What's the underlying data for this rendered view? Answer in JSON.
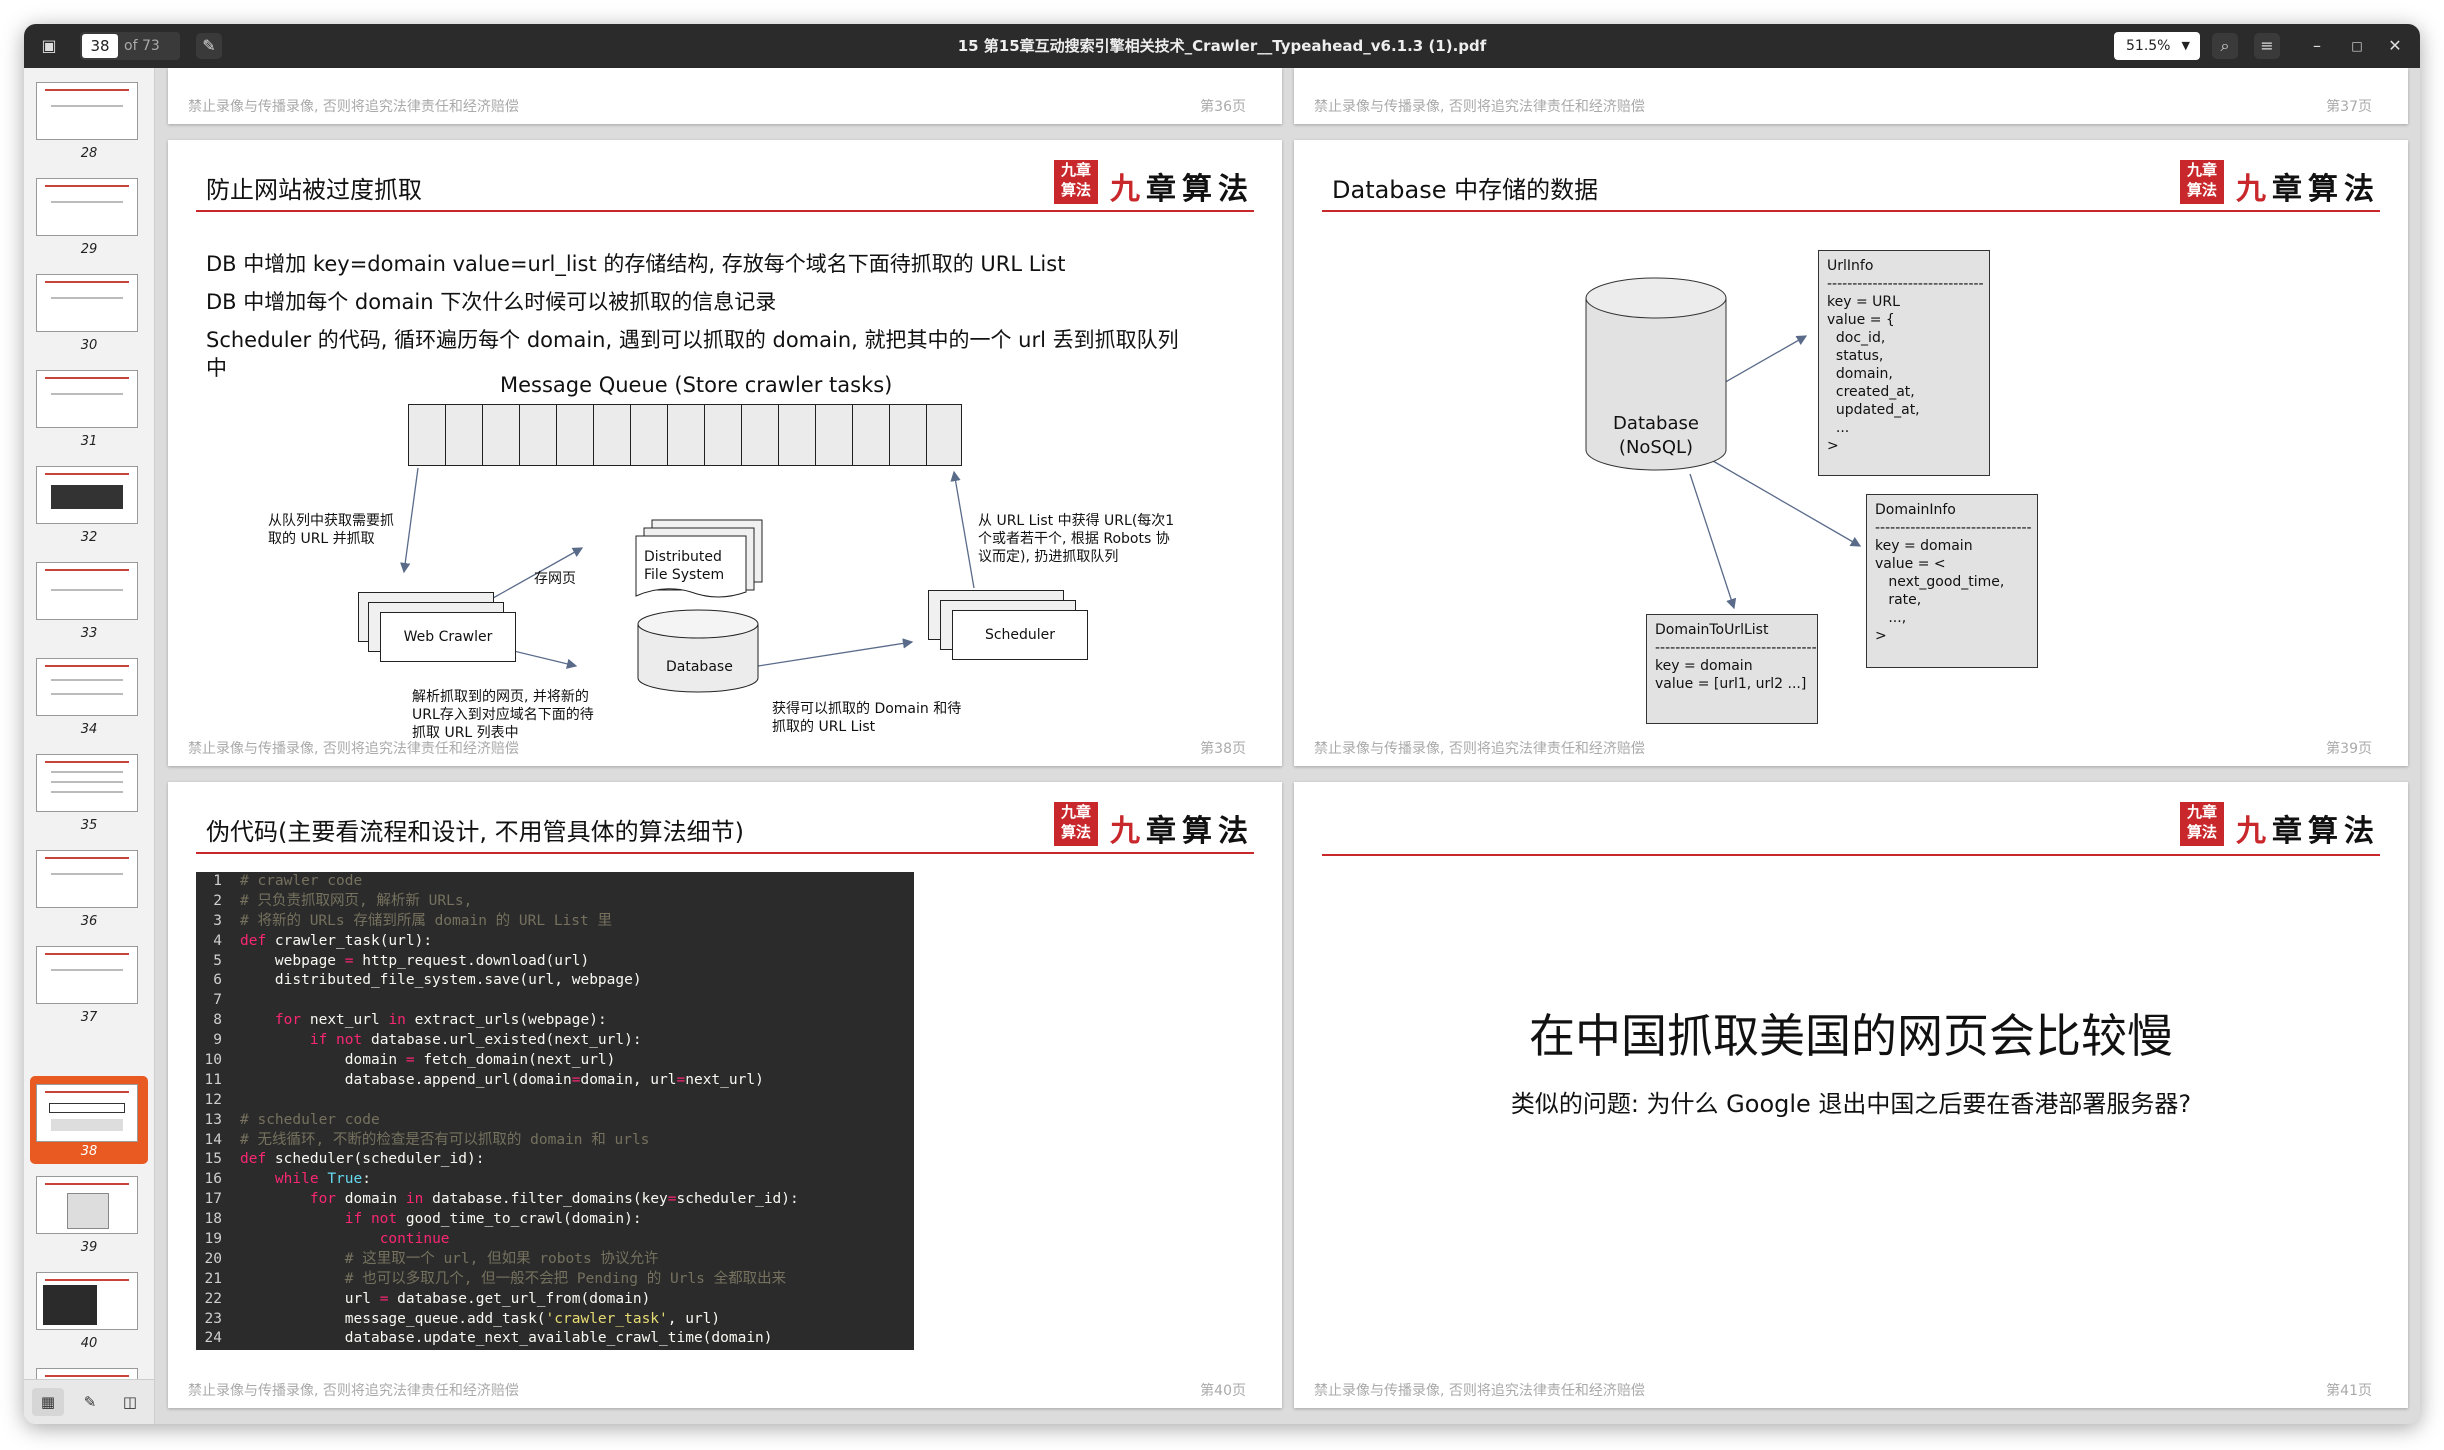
{
  "window": {
    "title": "15 第15章互动搜索引擎相关技术_Crawler__Typeahead_v6.1.3 (1).pdf",
    "page_current": "38",
    "page_total": "of 73",
    "zoom": "51.5%"
  },
  "sidebar": {
    "selected_page": "38",
    "thumbnails": [
      "28",
      "29",
      "30",
      "31",
      "32",
      "33",
      "34",
      "35",
      "36",
      "37",
      "38",
      "39",
      "40"
    ]
  },
  "footer_text": "禁止录像与传播录像, 否则将追究法律责任和经济赔偿",
  "logo": {
    "seal": "九章算法",
    "text": "九章算法"
  },
  "top_partial": {
    "left_page": "第36页",
    "right_page": "第37页"
  },
  "slide38": {
    "title": "防止网站被过度抓取",
    "page": "第38页",
    "bullets": [
      "DB 中增加 key=domain value=url_list 的存储结构, 存放每个域名下面待抓取的 URL List",
      "DB 中增加每个 domain 下次什么时候可以被抓取的信息记录",
      "Scheduler 的代码, 循环遍历每个 domain, 遇到可以抓取的 domain, 就把其中的一个 url 丢到抓取队列",
      "中"
    ],
    "diagram": {
      "queue_label": "Message Queue (Store crawler tasks)",
      "web_crawler": "Web Crawler",
      "dfs_line1": "Distributed",
      "dfs_line2": "File System",
      "database": "Database",
      "scheduler": "Scheduler",
      "note_fetch_1": "从队列中获取需要抓",
      "note_fetch_2": "取的 URL 并抓取",
      "note_store": "存网页",
      "note_sched_1": "从 URL List 中获得 URL(每次1",
      "note_sched_2": "个或者若干个, 根据 Robots 协",
      "note_sched_3": "议而定), 扔进抓取队列",
      "note_parse_1": "解析抓取到的网页, 并将新的",
      "note_parse_2": "URL存入到对应域名下面的待",
      "note_parse_3": "抓取 URL 列表中",
      "note_domain_1": "获得可以抓取的 Domain 和待",
      "note_domain_2": "抓取的 URL List"
    }
  },
  "slide39": {
    "title": "Database 中存储的数据",
    "page": "第39页",
    "db_line1": "Database",
    "db_line2": "(NoSQL)",
    "urlinfo": "UrlInfo\n-------------------------------\nkey = URL\nvalue = {\n  doc_id,\n  status,\n  domain,\n  created_at,\n  updated_at,\n  ...\n>",
    "domaininfo": "DomainInfo\n-------------------------------\nkey = domain\nvalue = <\n   next_good_time,\n   rate,\n   ...,\n>",
    "domaintourllist": "DomainToUrlList\n--------------------------------\nkey = domain\nvalue = [url1, url2 ...]"
  },
  "slide40": {
    "title": "伪代码(主要看流程和设计, 不用管具体的算法细节)",
    "page": "第40页"
  },
  "slide41": {
    "headline": "在中国抓取美国的网页会比较慢",
    "subline": "类似的问题: 为什么 Google 退出中国之后要在香港部署服务器?",
    "page": "第41页"
  }
}
